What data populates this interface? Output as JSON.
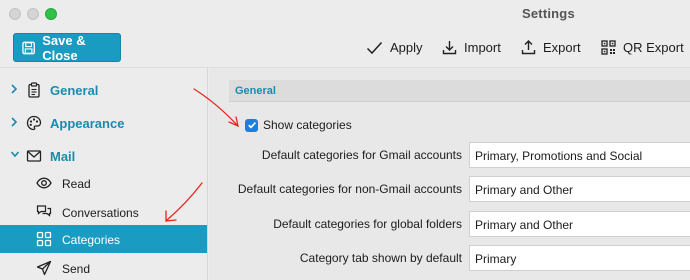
{
  "window": {
    "title": "Settings"
  },
  "toolbar": {
    "save_close": "Save & Close",
    "apply": "Apply",
    "import": "Import",
    "export": "Export",
    "qr_export": "QR Export"
  },
  "sidebar": {
    "items": [
      {
        "label": "General",
        "icon": "clipboard-icon",
        "expanded": false
      },
      {
        "label": "Appearance",
        "icon": "palette-icon",
        "expanded": false
      },
      {
        "label": "Mail",
        "icon": "envelope-icon",
        "expanded": true
      }
    ],
    "mail_subitems": [
      {
        "label": "Read",
        "icon": "eye-icon",
        "active": false
      },
      {
        "label": "Conversations",
        "icon": "chat-bubbles-icon",
        "active": false
      },
      {
        "label": "Categories",
        "icon": "grid-icon",
        "active": true
      },
      {
        "label": "Send",
        "icon": "send-icon",
        "active": false
      }
    ]
  },
  "main": {
    "section_title": "General",
    "show_categories": {
      "label": "Show categories",
      "checked": true
    },
    "fields": [
      {
        "label": "Default categories for Gmail accounts",
        "value": "Primary, Promotions and Social"
      },
      {
        "label": "Default categories for non-Gmail accounts",
        "value": "Primary and Other"
      },
      {
        "label": "Default categories for global folders",
        "value": "Primary and Other"
      },
      {
        "label": "Category tab shown by default",
        "value": "Primary"
      }
    ]
  },
  "colors": {
    "accent": "#1a9bc1",
    "annotation": "#e0281e",
    "checkbox": "#1a7fe0"
  }
}
